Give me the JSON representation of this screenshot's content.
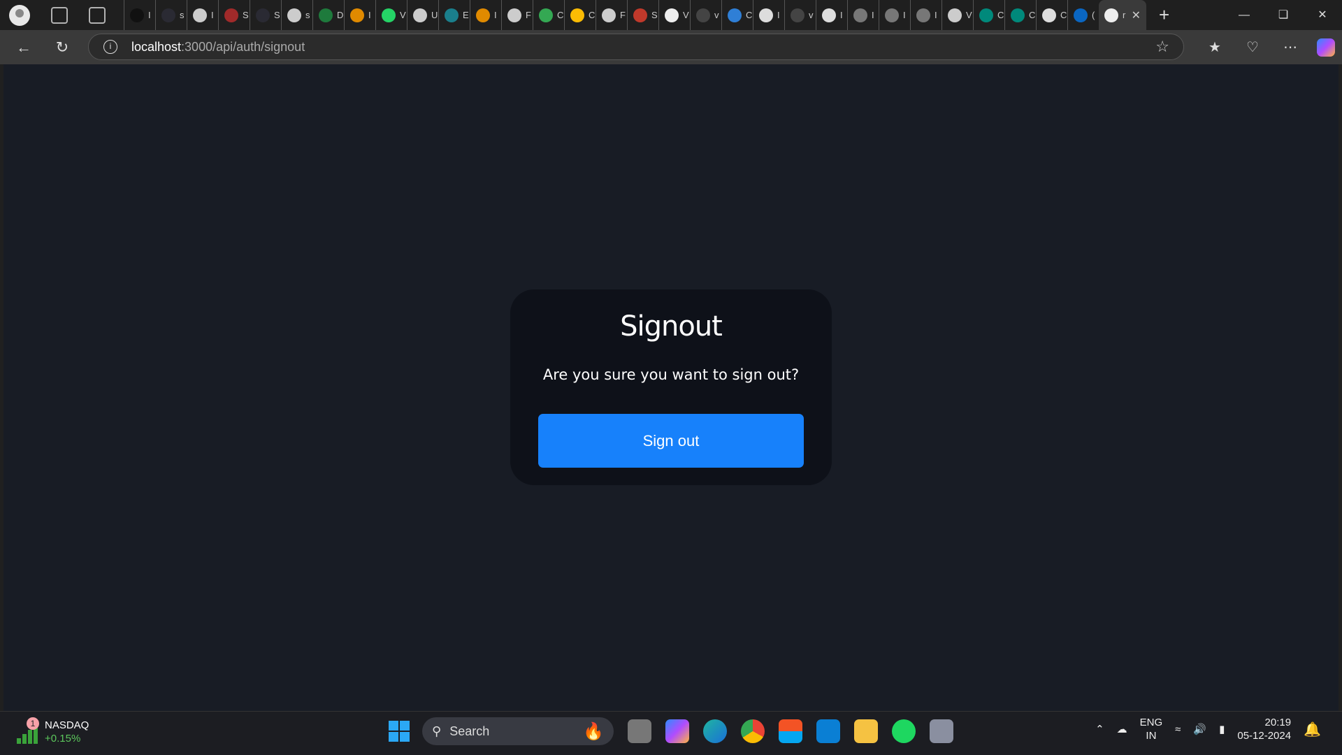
{
  "browser": {
    "tabs": [
      {
        "icon": "medium-icon",
        "color": "#111111",
        "label": "I"
      },
      {
        "icon": "crown-icon",
        "color": "#2a2a33",
        "label": "s"
      },
      {
        "icon": "github-icon",
        "color": "#cccccc",
        "label": "I"
      },
      {
        "icon": "crown-icon",
        "color": "#a02a2a",
        "label": "S"
      },
      {
        "icon": "crown-icon",
        "color": "#2a2a33",
        "label": "S"
      },
      {
        "icon": "github-icon",
        "color": "#cccccc",
        "label": "s"
      },
      {
        "icon": "mongodb-icon",
        "color": "#1e7a3c",
        "label": "D"
      },
      {
        "icon": "colab-icon",
        "color": "#e08a00",
        "label": "I"
      },
      {
        "icon": "whatsapp-icon",
        "color": "#25d366",
        "label": "V"
      },
      {
        "icon": "github-icon",
        "color": "#cccccc",
        "label": "U"
      },
      {
        "icon": "forms-icon",
        "color": "#1a7f8c",
        "label": "E"
      },
      {
        "icon": "colab-icon",
        "color": "#e08a00",
        "label": "I"
      },
      {
        "icon": "github-icon",
        "color": "#cccccc",
        "label": "F"
      },
      {
        "icon": "drive-icon",
        "color": "#34a853",
        "label": "C"
      },
      {
        "icon": "drive-icon",
        "color": "#fbbc04",
        "label": "C"
      },
      {
        "icon": "github-icon",
        "color": "#cccccc",
        "label": "F"
      },
      {
        "icon": "opera-icon",
        "color": "#c0392b",
        "label": "S"
      },
      {
        "icon": "notion-icon",
        "color": "#eeeeee",
        "label": "V"
      },
      {
        "icon": "search-icon",
        "color": "#444444",
        "label": "v"
      },
      {
        "icon": "jira-icon",
        "color": "#2f7fd6",
        "label": "C"
      },
      {
        "icon": "document-icon",
        "color": "#dddddd",
        "label": "I"
      },
      {
        "icon": "search-icon",
        "color": "#444444",
        "label": "v"
      },
      {
        "icon": "document-icon",
        "color": "#dddddd",
        "label": "I"
      },
      {
        "icon": "thumbnail-icon",
        "color": "#777777",
        "label": "I"
      },
      {
        "icon": "thumbnail-icon",
        "color": "#777777",
        "label": "I"
      },
      {
        "icon": "thumbnail-icon",
        "color": "#777777",
        "label": "I"
      },
      {
        "icon": "github-icon",
        "color": "#cccccc",
        "label": "V"
      },
      {
        "icon": "meet-icon",
        "color": "#00897b",
        "label": "C"
      },
      {
        "icon": "meet-icon",
        "color": "#00897b",
        "label": "C"
      },
      {
        "icon": "openai-icon",
        "color": "#dddddd",
        "label": "C"
      },
      {
        "icon": "linkedin-icon",
        "color": "#0a66c2",
        "label": "("
      }
    ],
    "active_tab": {
      "icon": "github-icon",
      "label": "r"
    },
    "url_host": "localhost",
    "url_rest": ":3000/api/auth/signout"
  },
  "card": {
    "title": "Signout",
    "message": "Are you sure you want to sign out?",
    "button_label": "Sign out",
    "button_color": "#1781fb"
  },
  "taskbar": {
    "widget": {
      "badge": "1",
      "name": "NASDAQ",
      "change": "+0.15%"
    },
    "search_label": "Search",
    "lang": "ENG",
    "region": "IN",
    "time": "20:19",
    "date": "05-12-2024"
  }
}
